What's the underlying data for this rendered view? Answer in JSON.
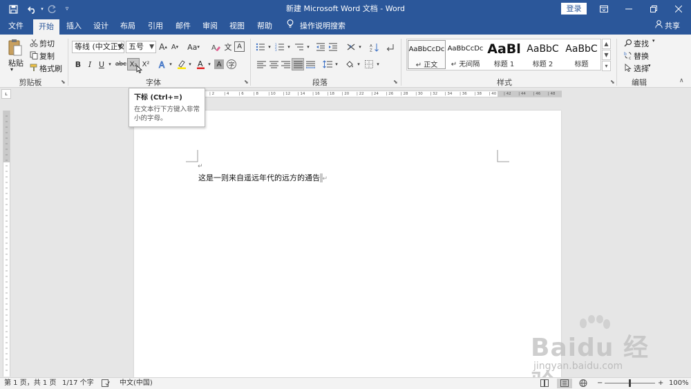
{
  "window": {
    "title": "新建 Microsoft Word 文档 - Word",
    "login_label": "登录",
    "quick_access": [
      "save-icon",
      "undo-icon",
      "redo-icon",
      "customize-icon"
    ]
  },
  "tabs": [
    {
      "label": "文件"
    },
    {
      "label": "开始",
      "active": true
    },
    {
      "label": "插入"
    },
    {
      "label": "设计"
    },
    {
      "label": "布局"
    },
    {
      "label": "引用"
    },
    {
      "label": "邮件"
    },
    {
      "label": "审阅"
    },
    {
      "label": "视图"
    },
    {
      "label": "帮助"
    }
  ],
  "tell_me": "操作说明搜索",
  "share_label": "共享",
  "clipboard": {
    "group_label": "剪贴板",
    "paste_label": "粘贴",
    "cut_label": "剪切",
    "copy_label": "复制",
    "format_painter_label": "格式刷"
  },
  "font": {
    "group_label": "字体",
    "font_name": "等线 (中文正文",
    "font_size": "五号",
    "bold": "B",
    "italic": "I",
    "underline": "U",
    "strike": "abc",
    "subscript": "X₂",
    "superscript": "X²",
    "grow": "A",
    "shrink": "A",
    "case": "Aa",
    "phonetic": "文",
    "border": "A",
    "highlight_color": "#ffe600",
    "font_color": "#e02020"
  },
  "paragraph": {
    "group_label": "段落"
  },
  "styles": {
    "group_label": "样式",
    "items": [
      {
        "preview": "AaBbCcDc",
        "name": "↵ 正文",
        "selected": true
      },
      {
        "preview": "AaBbCcDc",
        "name": "↵ 无间隔"
      },
      {
        "preview": "AaBl",
        "name": "标题 1"
      },
      {
        "preview": "AaBbC",
        "name": "标题 2"
      },
      {
        "preview": "AaBbC",
        "name": "标题"
      }
    ]
  },
  "editing": {
    "group_label": "编辑",
    "find_label": "查找",
    "replace_label": "替换",
    "select_label": "选择"
  },
  "tooltip": {
    "title": "下标 (Ctrl+=)",
    "description": "在文本行下方键入非常小的字母。"
  },
  "ruler": {
    "ticks": [
      "2",
      "4",
      "6",
      "8",
      "10",
      "12",
      "14",
      "16",
      "18",
      "20",
      "22",
      "24",
      "26",
      "28",
      "30",
      "32",
      "34",
      "36",
      "38",
      "40",
      "42",
      "44",
      "46",
      "48"
    ]
  },
  "document": {
    "text": "这是一则来自遥远年代的远方的通告",
    "paragraph_mark": "↵"
  },
  "status": {
    "page": "第 1 页，共 1 页",
    "words": "1/17 个字",
    "language": "中文(中国)",
    "zoom": "100%",
    "zoom_minus": "−",
    "zoom_plus": "+"
  },
  "watermark": {
    "brand": "Baidu 经验",
    "url": "jingyan.baidu.com"
  }
}
